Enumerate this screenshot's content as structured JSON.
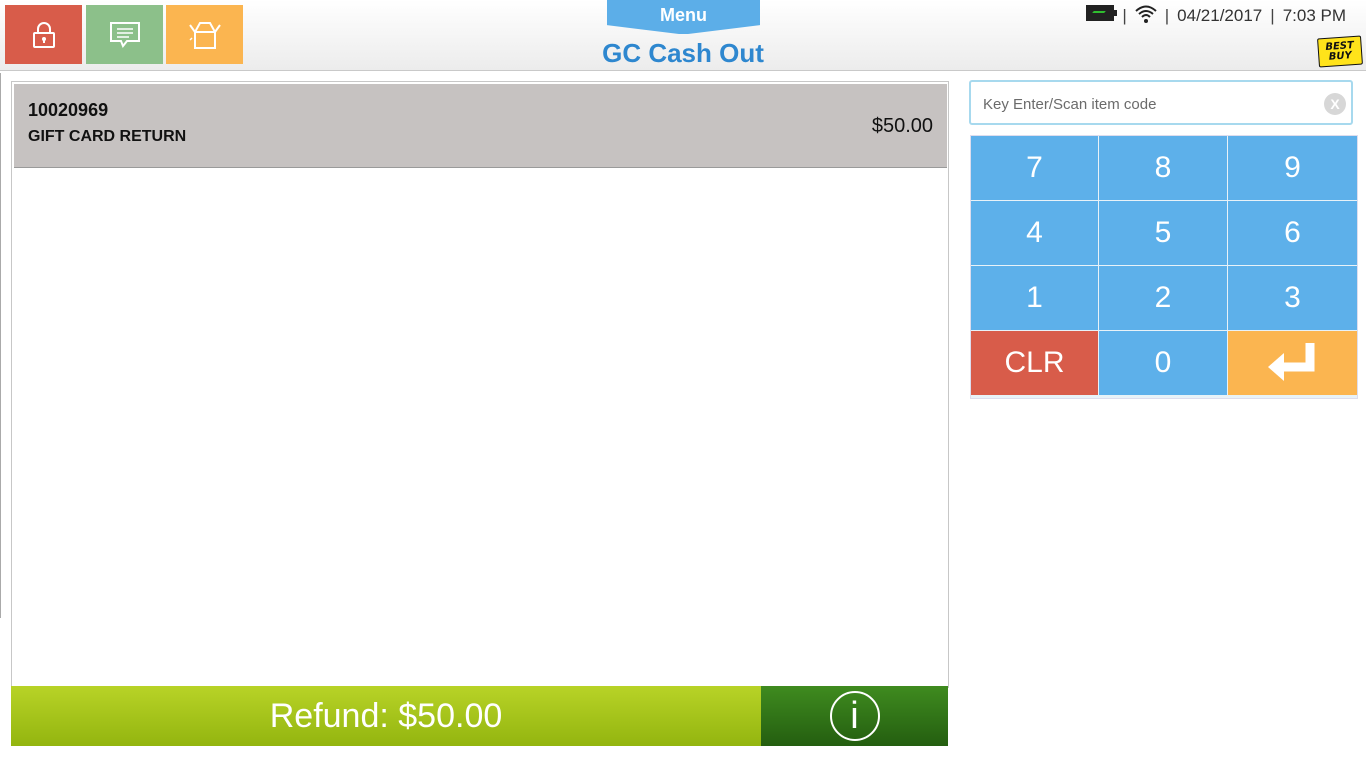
{
  "header": {
    "menu_label": "Menu",
    "title": "GC Cash Out",
    "date": "04/21/2017",
    "time": "7:03 PM",
    "separator": "|",
    "logo_line1": "BEST",
    "logo_line2": "BUY"
  },
  "toolbar": {
    "icons": [
      "lock-icon",
      "message-icon",
      "box-icon"
    ],
    "colors": {
      "lock": "#d85c4a",
      "message": "#8cc08a",
      "box": "#fbb550"
    }
  },
  "items": [
    {
      "code": "10020969",
      "name": "GIFT CARD RETURN",
      "price": "$50.00"
    }
  ],
  "footer": {
    "refund_label": "Refund: $50.00",
    "info_label": "i"
  },
  "search": {
    "placeholder": "Key Enter/Scan item code",
    "value": "",
    "clear_label": "X"
  },
  "keypad": {
    "keys": [
      "7",
      "8",
      "9",
      "4",
      "5",
      "6",
      "1",
      "2",
      "3",
      "CLR",
      "0",
      "enter-icon"
    ]
  },
  "colors": {
    "accent": "#2e87cf",
    "keypad": "#5db0ea",
    "refund": "#a6c41a",
    "info": "#2f741a"
  }
}
